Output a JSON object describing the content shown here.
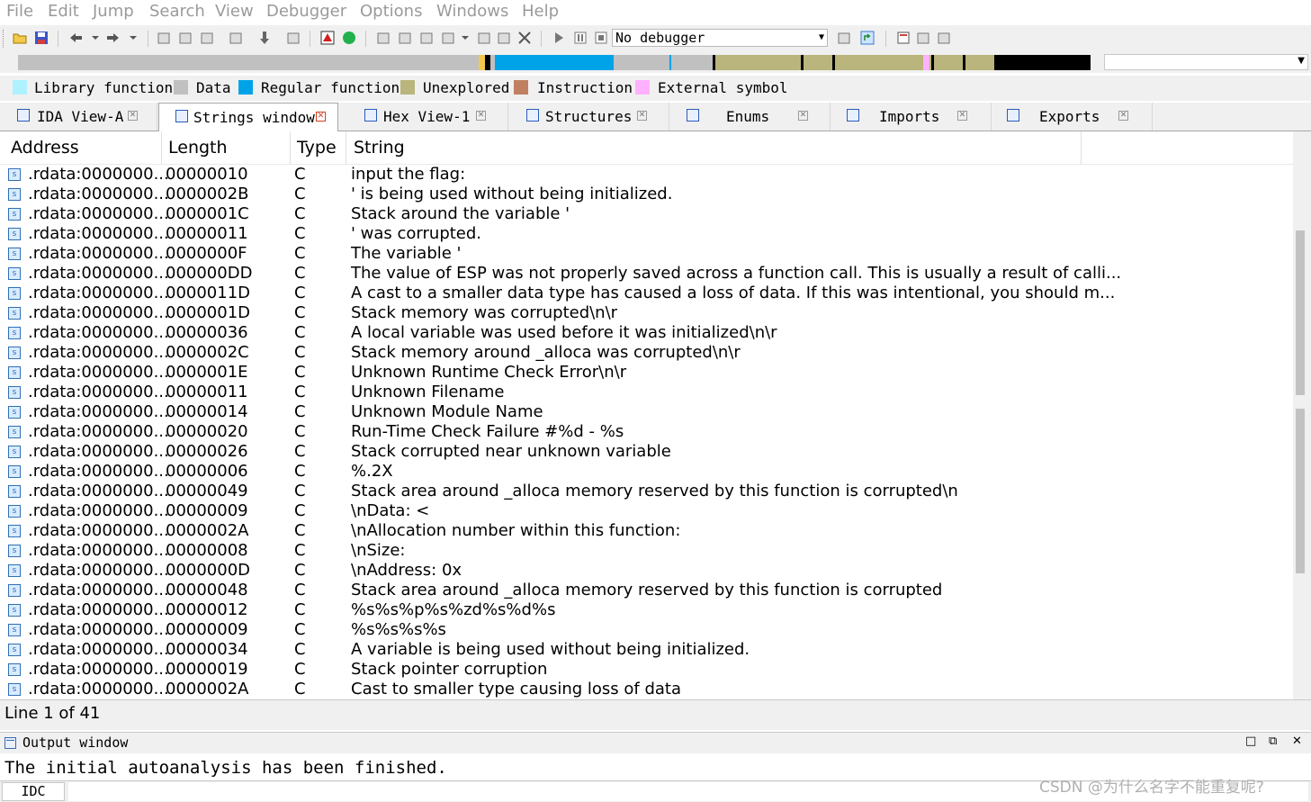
{
  "menu": [
    "File",
    "Edit",
    "Jump",
    "Search",
    "View",
    "Debugger",
    "Options",
    "Windows",
    "Help"
  ],
  "toolbar": {
    "debugger_select": "No debugger"
  },
  "legend": [
    {
      "label": "Library function",
      "color": "#aef2ff"
    },
    {
      "label": "Data",
      "color": "#c0c0c0"
    },
    {
      "label": "Regular function",
      "color": "#00a3e8"
    },
    {
      "label": "Unexplored",
      "color": "#b9b57c"
    },
    {
      "label": "Instruction",
      "color": "#c08060"
    },
    {
      "label": "External symbol",
      "color": "#ffb0ff"
    }
  ],
  "tabs": [
    {
      "label": "IDA View-A",
      "icon": "ida-view-icon",
      "active": false
    },
    {
      "label": "Strings window",
      "icon": "strings-icon",
      "active": true
    },
    {
      "label": "Hex View-1",
      "icon": "hex-view-icon",
      "active": false
    },
    {
      "label": "Structures",
      "icon": "structures-icon",
      "active": false
    },
    {
      "label": "Enums",
      "icon": "enums-icon",
      "active": false
    },
    {
      "label": "Imports",
      "icon": "imports-icon",
      "active": false
    },
    {
      "label": "Exports",
      "icon": "exports-icon",
      "active": false
    }
  ],
  "columns": [
    "Address",
    "Length",
    "Type",
    "String"
  ],
  "rows": [
    {
      "address": ".rdata:0000000...",
      "length": "00000010",
      "type": "C",
      "string": "input the flag:"
    },
    {
      "address": ".rdata:0000000...",
      "length": "0000002B",
      "type": "C",
      "string": "' is being used without being initialized."
    },
    {
      "address": ".rdata:0000000...",
      "length": "0000001C",
      "type": "C",
      "string": "Stack around the variable '"
    },
    {
      "address": ".rdata:0000000...",
      "length": "00000011",
      "type": "C",
      "string": "' was corrupted."
    },
    {
      "address": ".rdata:0000000...",
      "length": "0000000F",
      "type": "C",
      "string": "The variable '"
    },
    {
      "address": ".rdata:0000000...",
      "length": "000000DD",
      "type": "C",
      "string": "The value of ESP was not properly saved across a function call.  This is usually a result of calli..."
    },
    {
      "address": ".rdata:0000000...",
      "length": "0000011D",
      "type": "C",
      "string": "A cast to a smaller data type has caused a loss of data.  If this was intentional, you should m..."
    },
    {
      "address": ".rdata:0000000...",
      "length": "0000001D",
      "type": "C",
      "string": "Stack memory was corrupted\\n\\r"
    },
    {
      "address": ".rdata:0000000...",
      "length": "00000036",
      "type": "C",
      "string": "A local variable was used before it was initialized\\n\\r"
    },
    {
      "address": ".rdata:0000000...",
      "length": "0000002C",
      "type": "C",
      "string": "Stack memory around _alloca was corrupted\\n\\r"
    },
    {
      "address": ".rdata:0000000...",
      "length": "0000001E",
      "type": "C",
      "string": "Unknown Runtime Check Error\\n\\r"
    },
    {
      "address": ".rdata:0000000...",
      "length": "00000011",
      "type": "C",
      "string": "Unknown Filename"
    },
    {
      "address": ".rdata:0000000...",
      "length": "00000014",
      "type": "C",
      "string": "Unknown Module Name"
    },
    {
      "address": ".rdata:0000000...",
      "length": "00000020",
      "type": "C",
      "string": "Run-Time Check Failure #%d - %s"
    },
    {
      "address": ".rdata:0000000...",
      "length": "00000026",
      "type": "C",
      "string": "Stack corrupted near unknown variable"
    },
    {
      "address": ".rdata:0000000...",
      "length": "00000006",
      "type": "C",
      "string": "%.2X "
    },
    {
      "address": ".rdata:0000000...",
      "length": "00000049",
      "type": "C",
      "string": "Stack area around _alloca memory reserved by this function is corrupted\\n"
    },
    {
      "address": ".rdata:0000000...",
      "length": "00000009",
      "type": "C",
      "string": "\\nData: <"
    },
    {
      "address": ".rdata:0000000...",
      "length": "0000002A",
      "type": "C",
      "string": "\\nAllocation number within this function: "
    },
    {
      "address": ".rdata:0000000...",
      "length": "00000008",
      "type": "C",
      "string": "\\nSize: "
    },
    {
      "address": ".rdata:0000000...",
      "length": "0000000D",
      "type": "C",
      "string": "\\nAddress: 0x"
    },
    {
      "address": ".rdata:0000000...",
      "length": "00000048",
      "type": "C",
      "string": "Stack area around _alloca memory reserved by this function is corrupted"
    },
    {
      "address": ".rdata:0000000...",
      "length": "00000012",
      "type": "C",
      "string": "%s%s%p%s%zd%s%d%s"
    },
    {
      "address": ".rdata:0000000...",
      "length": "00000009",
      "type": "C",
      "string": "%s%s%s%s"
    },
    {
      "address": ".rdata:0000000...",
      "length": "00000034",
      "type": "C",
      "string": "A variable is being used without being initialized."
    },
    {
      "address": ".rdata:0000000...",
      "length": "00000019",
      "type": "C",
      "string": "Stack pointer corruption"
    },
    {
      "address": ".rdata:0000000...",
      "length": "0000002A",
      "type": "C",
      "string": "Cast to smaller type causing loss of data"
    }
  ],
  "status": "Line 1 of 41",
  "output": {
    "title": "Output window",
    "text": "The initial autoanalysis has been finished.",
    "idc_label": "IDC"
  },
  "watermark": "CSDN @为什么名字不能重复呢?"
}
